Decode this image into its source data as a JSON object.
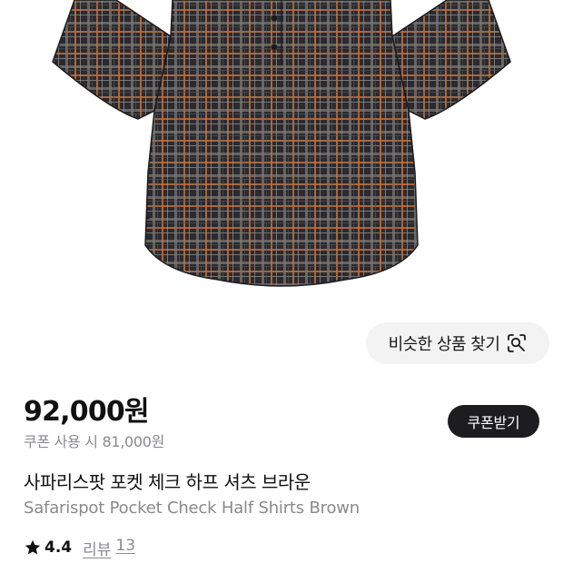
{
  "product": {
    "image_alt": "plaid short-sleeve shirt",
    "similar_button_label": "비슷한 상품 찾기",
    "similar_icon": "visual-search-icon",
    "price": "92,000원",
    "coupon_price": "쿠폰 사용 시 81,000원",
    "coupon_button_label": "쿠폰받기",
    "name_ko": "사파리스팟 포켓 체크 하프 셔츠 브라운",
    "name_en": "Safarispot Pocket Check Half Shirts Brown",
    "rating_icon": "star-icon",
    "rating": "4.4",
    "review_label": "리뷰",
    "review_count": "13"
  },
  "colors": {
    "background": "#ffffff",
    "shirt_base": "#2b2a30",
    "plaid_orange": "#c0703a",
    "plaid_grey": "#8d8a86",
    "button_dark": "#1d1d1f",
    "button_light": "#f3f3f4",
    "muted_text": "#8a8a8e"
  }
}
